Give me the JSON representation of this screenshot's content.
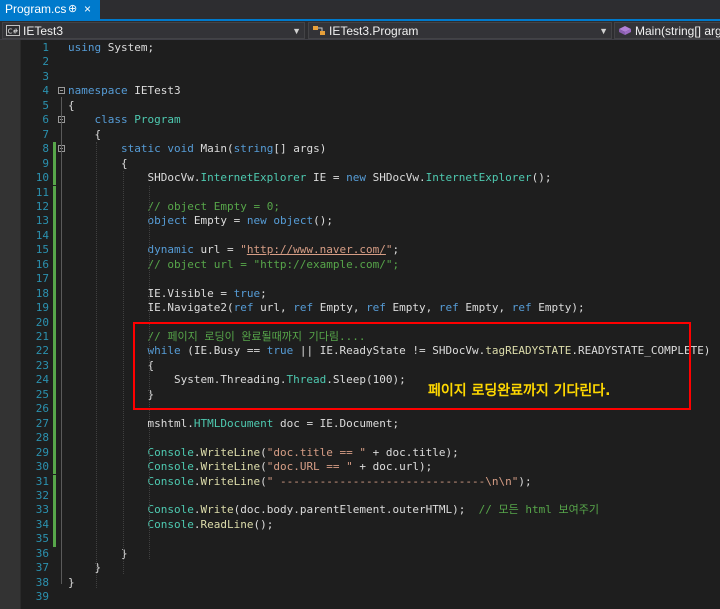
{
  "tab": {
    "filename": "Program.cs",
    "pin_glyph": "⊕",
    "close_glyph": "×"
  },
  "nav": {
    "project_badge": "C#",
    "project": "IETest3",
    "type": "IETest3.Program",
    "member": "Main(string[] args)"
  },
  "annotation": "페이지 로딩완료까지 기다린다.",
  "lines": [
    {
      "n": "1",
      "code": "using System;"
    },
    {
      "n": "2",
      "code": ""
    },
    {
      "n": "3",
      "code": ""
    },
    {
      "n": "4",
      "code": "namespace IETest3"
    },
    {
      "n": "5",
      "code": "{"
    },
    {
      "n": "6",
      "code": "    class Program"
    },
    {
      "n": "7",
      "code": "    {"
    },
    {
      "n": "8",
      "code": "        static void Main(string[] args)"
    },
    {
      "n": "9",
      "code": "        {"
    },
    {
      "n": "10",
      "code": "            SHDocVw.InternetExplorer IE = new SHDocVw.InternetExplorer();"
    },
    {
      "n": "11",
      "code": ""
    },
    {
      "n": "12",
      "code": "            // object Empty = 0;"
    },
    {
      "n": "13",
      "code": "            object Empty = new object();"
    },
    {
      "n": "14",
      "code": ""
    },
    {
      "n": "15",
      "code": "            dynamic url = \"http://www.naver.com/\";"
    },
    {
      "n": "16",
      "code": "            // object url = \"http://example.com/\";"
    },
    {
      "n": "17",
      "code": ""
    },
    {
      "n": "18",
      "code": "            IE.Visible = true;"
    },
    {
      "n": "19",
      "code": "            IE.Navigate2(ref url, ref Empty, ref Empty, ref Empty, ref Empty);"
    },
    {
      "n": "20",
      "code": ""
    },
    {
      "n": "21",
      "code": "            // 페이지 로딩이 완료될때까지 기다림...."
    },
    {
      "n": "22",
      "code": "            while (IE.Busy == true || IE.ReadyState != SHDocVw.tagREADYSTATE.READYSTATE_COMPLETE)"
    },
    {
      "n": "23",
      "code": "            {"
    },
    {
      "n": "24",
      "code": "                System.Threading.Thread.Sleep(100);"
    },
    {
      "n": "25",
      "code": "            }"
    },
    {
      "n": "26",
      "code": ""
    },
    {
      "n": "27",
      "code": "            mshtml.HTMLDocument doc = IE.Document;"
    },
    {
      "n": "28",
      "code": ""
    },
    {
      "n": "29",
      "code": "            Console.WriteLine(\"doc.title == \" + doc.title);"
    },
    {
      "n": "30",
      "code": "            Console.WriteLine(\"doc.URL == \" + doc.url);"
    },
    {
      "n": "31",
      "code": "            Console.WriteLine(\" -------------------------------\\n\\n\");"
    },
    {
      "n": "32",
      "code": ""
    },
    {
      "n": "33",
      "code": "            Console.Write(doc.body.parentElement.outerHTML);  // 모든 html 보여주기"
    },
    {
      "n": "34",
      "code": "            Console.ReadLine();"
    },
    {
      "n": "35",
      "code": ""
    },
    {
      "n": "36",
      "code": "        }"
    },
    {
      "n": "37",
      "code": "    }"
    },
    {
      "n": "38",
      "code": "}"
    },
    {
      "n": "39",
      "code": ""
    }
  ],
  "colors": {
    "keyword": "#569cd6",
    "type": "#4ec9b0",
    "method": "#dcdcaa",
    "string": "#d69d85",
    "comment": "#57a64a",
    "line_number": "#2b91af",
    "highlight_box": "#ff0000",
    "annotation_text": "#ffd800",
    "accent": "#007acc"
  }
}
